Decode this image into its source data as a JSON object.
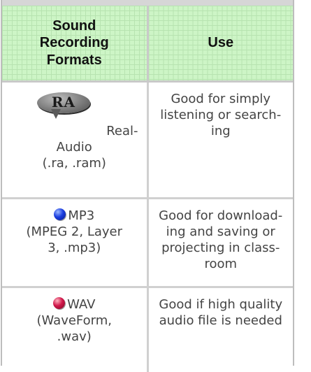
{
  "table": {
    "headers": {
      "format": [
        "Sound",
        "Recording",
        "Formats"
      ],
      "use": "Use"
    },
    "rows": [
      {
        "icon": "realaudio-icon",
        "icon_text": "RA",
        "format_lines": [
          "Real-",
          "Audio",
          "(.ra, .ram)"
        ],
        "use_lines": [
          "Good for simply",
          "listening or search-",
          "ing"
        ]
      },
      {
        "icon": "blue-ball-icon",
        "format_lines": [
          "MP3",
          "(MPEG 2, Layer",
          "3, .mp3)"
        ],
        "use_lines": [
          "Good for download-",
          "ing and saving or",
          "projecting in class-",
          "room"
        ]
      },
      {
        "icon": "red-ball-icon",
        "format_lines": [
          "WAV",
          "(WaveForm,",
          ".wav)"
        ],
        "use_lines": [
          "Good if high quality",
          "audio file is needed"
        ]
      }
    ]
  },
  "colors": {
    "header_bg": "#cdf5c6",
    "header_grid": "#b7e3b0",
    "border": "#d0d0d0",
    "mp3_ball": "#1b3ee0",
    "wav_ball": "#d0174a"
  }
}
